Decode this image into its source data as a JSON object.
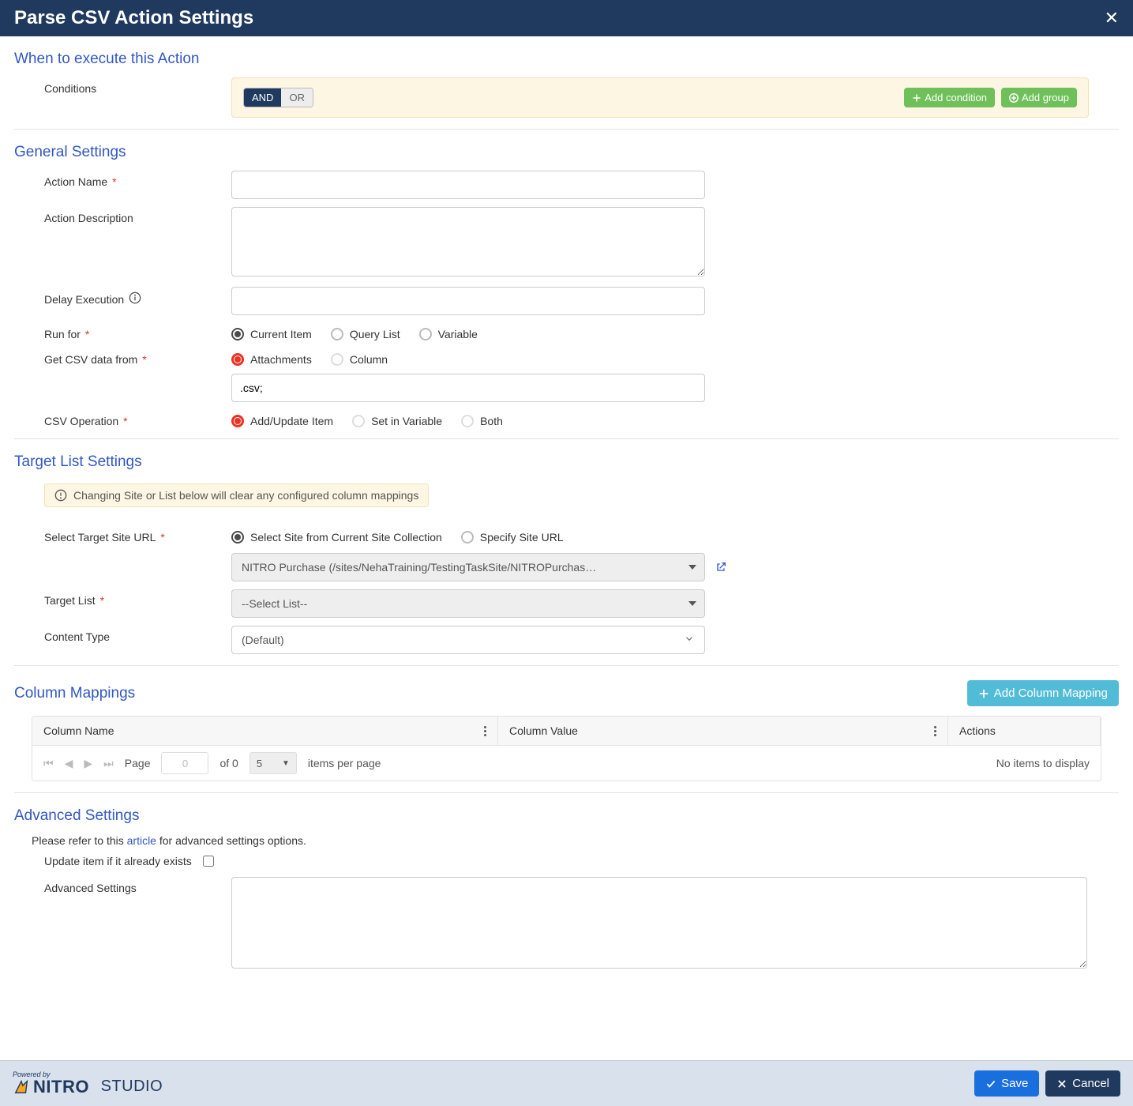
{
  "header": {
    "title": "Parse CSV Action Settings"
  },
  "sections": {
    "when": {
      "title": "When to execute this Action",
      "conditions_label": "Conditions",
      "and": "AND",
      "or": "OR",
      "add_condition": "Add condition",
      "add_group": "Add group"
    },
    "general": {
      "title": "General Settings",
      "action_name_label": "Action Name",
      "action_desc_label": "Action Description",
      "delay_label": "Delay Execution",
      "runfor_label": "Run for",
      "runfor_options": {
        "current": "Current Item",
        "query": "Query List",
        "variable": "Variable"
      },
      "getcsv_label": "Get CSV data from",
      "getcsv_options": {
        "attachments": "Attachments",
        "column": "Column"
      },
      "csv_ext_value": ".csv;",
      "csvop_label": "CSV Operation",
      "csvop_options": {
        "addupdate": "Add/Update Item",
        "setvar": "Set in Variable",
        "both": "Both"
      }
    },
    "target": {
      "title": "Target List Settings",
      "warn": "Changing Site or List below will clear any configured column mappings",
      "site_label": "Select Target Site URL",
      "site_options": {
        "collection": "Select Site from Current Site Collection",
        "specify": "Specify Site URL"
      },
      "site_dropdown": "NITRO Purchase (/sites/NehaTraining/TestingTaskSite/NITROPurchas…",
      "tlist_label": "Target List",
      "tlist_value": "--Select List--",
      "ctype_label": "Content Type",
      "ctype_value": "(Default)"
    },
    "mappings": {
      "title": "Column Mappings",
      "add_button": "Add Column Mapping",
      "columns": {
        "name": "Column Name",
        "value": "Column Value",
        "actions": "Actions"
      },
      "pager": {
        "page_label": "Page",
        "page_value": "0",
        "of": "of 0",
        "per_page_value": "5",
        "per_page_label": "items per page",
        "empty": "No items to display"
      }
    },
    "advanced": {
      "title": "Advanced Settings",
      "help_prefix": "Please refer to this ",
      "help_link": "article",
      "help_suffix": " for advanced settings options.",
      "update_label": "Update item if it already exists",
      "adv_label": "Advanced Settings"
    }
  },
  "footer": {
    "powered": "Powered by",
    "brand": "NITRO",
    "brand2": "STUDIO",
    "save": "Save",
    "cancel": "Cancel"
  }
}
